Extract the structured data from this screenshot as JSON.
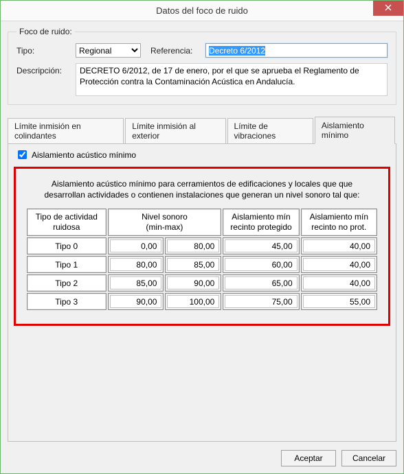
{
  "window": {
    "title": "Datos del foco de ruido"
  },
  "group": {
    "legend": "Foco de ruido:"
  },
  "fields": {
    "tipo_label": "Tipo:",
    "tipo_value": "Regional",
    "ref_label": "Referencia:",
    "ref_value": "Decreto 6/2012",
    "desc_label": "Descripción:",
    "desc_value": "DECRETO 6/2012, de 17 de enero, por el que se aprueba el Reglamento de Protección contra la Contaminación Acústica en Andalucía."
  },
  "tabs": {
    "t0": "Límite inmisión en colindantes",
    "t1": "Límite inmisión al exterior",
    "t2": "Límite de vibraciones",
    "t3": "Aislamiento mínimo"
  },
  "checkbox": {
    "label": "Aislamiento acústico mínimo",
    "checked": true
  },
  "redbox": {
    "caption_l1": "Aislamiento acústico mínimo para cerramientos de edificaciones y locales que que",
    "caption_l2": "desarrollan actividades o contienen instalaciones que generan un nivel sonoro tal que:"
  },
  "table": {
    "headers": {
      "h1_l1": "Tipo de actividad",
      "h1_l2": "ruidosa",
      "h2_l1": "Nivel sonoro",
      "h2_l2": "(min-max)",
      "h3_l1": "Aislamiento mín",
      "h3_l2": "recinto protegido",
      "h4_l1": "Aislamiento mín",
      "h4_l2": "recinto no prot."
    },
    "rows": [
      {
        "label": "Tipo 0",
        "min": "0,00",
        "max": "80,00",
        "prot": "45,00",
        "noprot": "40,00"
      },
      {
        "label": "Tipo 1",
        "min": "80,00",
        "max": "85,00",
        "prot": "60,00",
        "noprot": "40,00"
      },
      {
        "label": "Tipo 2",
        "min": "85,00",
        "max": "90,00",
        "prot": "65,00",
        "noprot": "40,00"
      },
      {
        "label": "Tipo 3",
        "min": "90,00",
        "max": "100,00",
        "prot": "75,00",
        "noprot": "55,00"
      }
    ]
  },
  "buttons": {
    "ok": "Aceptar",
    "cancel": "Cancelar"
  }
}
